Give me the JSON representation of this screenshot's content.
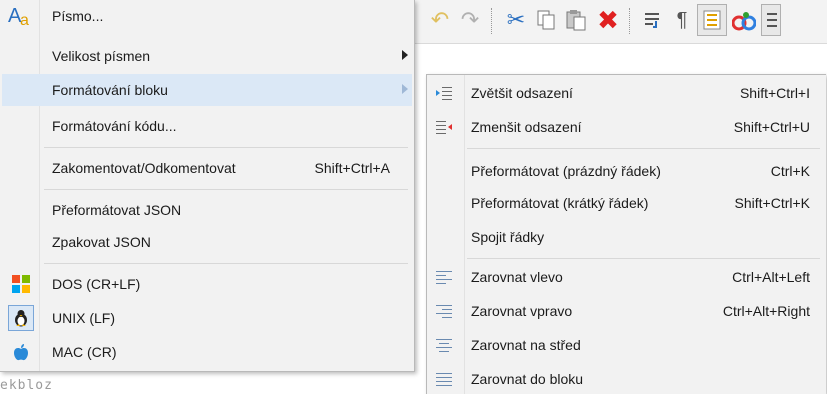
{
  "main_menu": {
    "items": [
      {
        "label": "Písmo...",
        "icon": "font-icon"
      },
      {
        "label": "Velikost písmen",
        "has_submenu": true
      },
      {
        "label": "Formátování bloku",
        "has_submenu": true,
        "highlighted": true
      },
      {
        "label": "Formátování kódu..."
      },
      {
        "label": "Zakomentovat/Odkomentovat",
        "shortcut": "Shift+Ctrl+A"
      },
      {
        "label": "Přeformátovat JSON"
      },
      {
        "label": "Zpakovat JSON"
      },
      {
        "label": "DOS  (CR+LF)",
        "icon": "windows-logo-icon"
      },
      {
        "label": "UNIX  (LF)",
        "icon": "linux-tux-icon",
        "checked": true
      },
      {
        "label": "MAC  (CR)",
        "icon": "apple-logo-icon"
      }
    ]
  },
  "submenu": {
    "items": [
      {
        "label": "Zvětšit odsazení",
        "shortcut": "Shift+Ctrl+I",
        "icon": "indent-increase-icon"
      },
      {
        "label": "Zmenšit odsazení",
        "shortcut": "Shift+Ctrl+U",
        "icon": "indent-decrease-icon"
      },
      {
        "label": "Přeformátovat (prázdný řádek)",
        "shortcut": "Ctrl+K"
      },
      {
        "label": "Přeformátovat (krátký řádek)",
        "shortcut": "Shift+Ctrl+K"
      },
      {
        "label": "Spojit řádky"
      },
      {
        "label": "Zarovnat vlevo",
        "shortcut": "Ctrl+Alt+Left",
        "icon": "align-left-icon"
      },
      {
        "label": "Zarovnat vpravo",
        "shortcut": "Ctrl+Alt+Right",
        "icon": "align-right-icon"
      },
      {
        "label": "Zarovnat na střed",
        "icon": "align-center-icon"
      },
      {
        "label": "Zarovnat do bloku",
        "icon": "align-justify-icon"
      }
    ]
  },
  "toolbar": {
    "icons": [
      "undo-icon",
      "redo-icon",
      "cut-icon",
      "copy-icon",
      "paste-icon",
      "delete-icon",
      "word-wrap-icon",
      "pilcrow-icon",
      "line-numbers-icon",
      "syntax-icon",
      "outline-icon"
    ]
  },
  "editor": {
    "visible_text": "ekbloz"
  },
  "colors": {
    "highlight": "#dbe8f6",
    "menu_bg": "#f2f2f2",
    "delete_red": "#e02020"
  }
}
